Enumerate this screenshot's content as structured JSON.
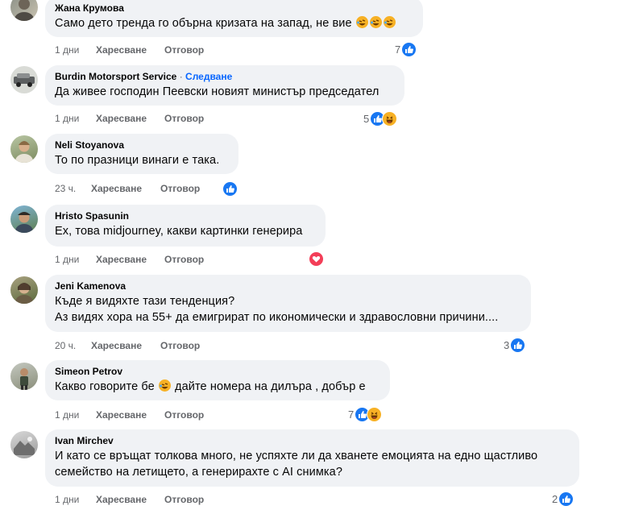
{
  "comments": [
    {
      "author": "Жана Крумова",
      "text": "Само дето тренда го обърна кризата на запад, не вие",
      "text_emojis": [
        "rolling-laughing",
        "rolling-laughing",
        "rolling-laughing"
      ],
      "time": "1 дни",
      "like_label": "Харесване",
      "reply_label": "Отговор",
      "reaction_count": "7",
      "reactions": [
        "like"
      ]
    },
    {
      "author": "Burdin Motorsport Service",
      "separator": " · ",
      "follow_label": "Следване",
      "text": "Да живее господин Пеевски новият министър председател",
      "time": "1 дни",
      "like_label": "Харесване",
      "reply_label": "Отговор",
      "reaction_count": "5",
      "reactions": [
        "like",
        "haha"
      ]
    },
    {
      "author": "Neli Stoyanova",
      "text": "То по празници винаги е така.",
      "time": "23 ч.",
      "like_label": "Харесване",
      "reply_label": "Отговор",
      "reaction_count": "",
      "reactions": [
        "like"
      ]
    },
    {
      "author": "Hristo Spasunin",
      "text": "Ех, това midjourney, какви картинки генерира",
      "time": "1 дни",
      "like_label": "Харесване",
      "reply_label": "Отговор",
      "reaction_count": "",
      "reactions": [
        "love"
      ]
    },
    {
      "author": "Jeni Kamenova",
      "text_line1": "Къде я видяхте тази тенденция?",
      "text_line2": "Аз видях хора на 55+ да емигрират по икономически и здравословни причини....",
      "time": "20 ч.",
      "like_label": "Харесване",
      "reply_label": "Отговор",
      "reaction_count": "3",
      "reactions": [
        "like"
      ]
    },
    {
      "author": "Simeon Petrov",
      "text_before": "Какво говорите бе",
      "text_after": " дайте номера на дилъра , добър е",
      "text_emojis": [
        "rolling-laughing"
      ],
      "time": "1 дни",
      "like_label": "Харесване",
      "reply_label": "Отговор",
      "reaction_count": "7",
      "reactions": [
        "like",
        "haha"
      ]
    },
    {
      "author": "Ivan Mirchev",
      "text_line1": "И като се връщат толкова много, не успяхте ли да хванете емоцията на едно щастливо",
      "text_line2": "семейство на летището, а генерирахте с AI снимка?",
      "time": "1 дни",
      "like_label": "Харесване",
      "reply_label": "Отговор",
      "reaction_count": "2",
      "reactions": [
        "like"
      ]
    }
  ],
  "colors": {
    "bubble": "#f0f2f5",
    "meta": "#65676b",
    "follow": "#0866ff",
    "like": "#1877f2",
    "love": "#f33e58",
    "haha": "#f7b125"
  }
}
